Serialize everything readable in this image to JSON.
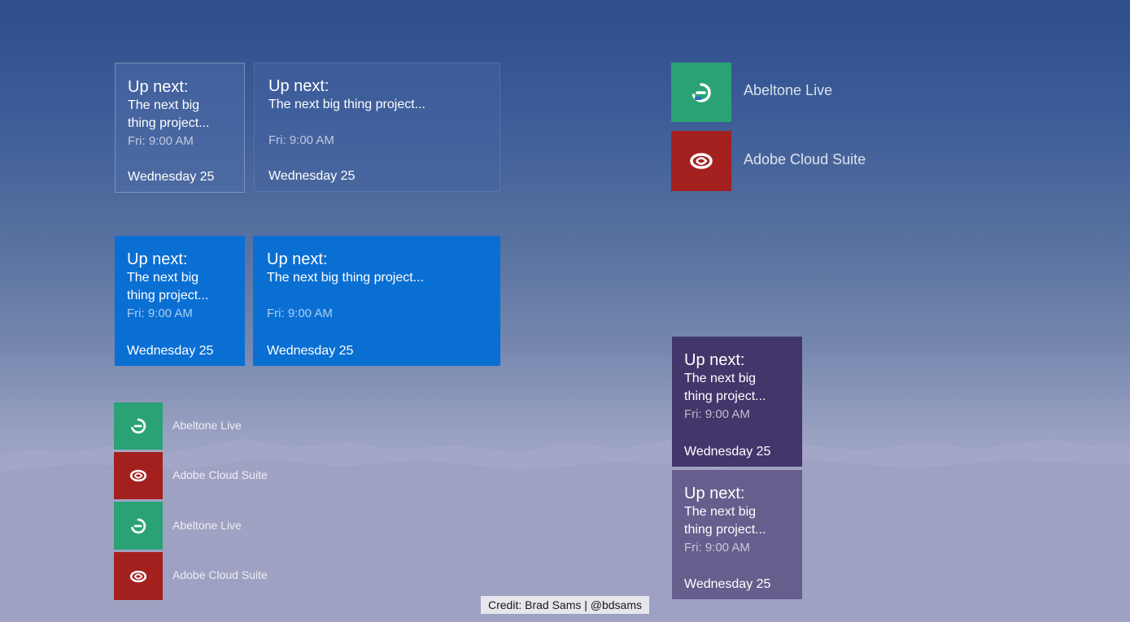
{
  "calendar_tile": {
    "up_next": "Up next:",
    "event_wrapped_line1": "The next big",
    "event_wrapped_line2": "thing project...",
    "event_full": "The next big thing project...",
    "time": "Fri: 9:00 AM",
    "date": "Wednesday 25"
  },
  "apps": {
    "abletone": {
      "name": "Abeltone Live",
      "icon": "ableton-live-icon",
      "color": "#2aa275"
    },
    "adobe": {
      "name": "Adobe Cloud Suite",
      "icon": "creative-cloud-icon",
      "color": "#a3201e"
    }
  },
  "colors": {
    "accent_blue": "#0a6fd3",
    "purple": "#43366b"
  },
  "credit": "Credit: Brad Sams | @bdsams"
}
